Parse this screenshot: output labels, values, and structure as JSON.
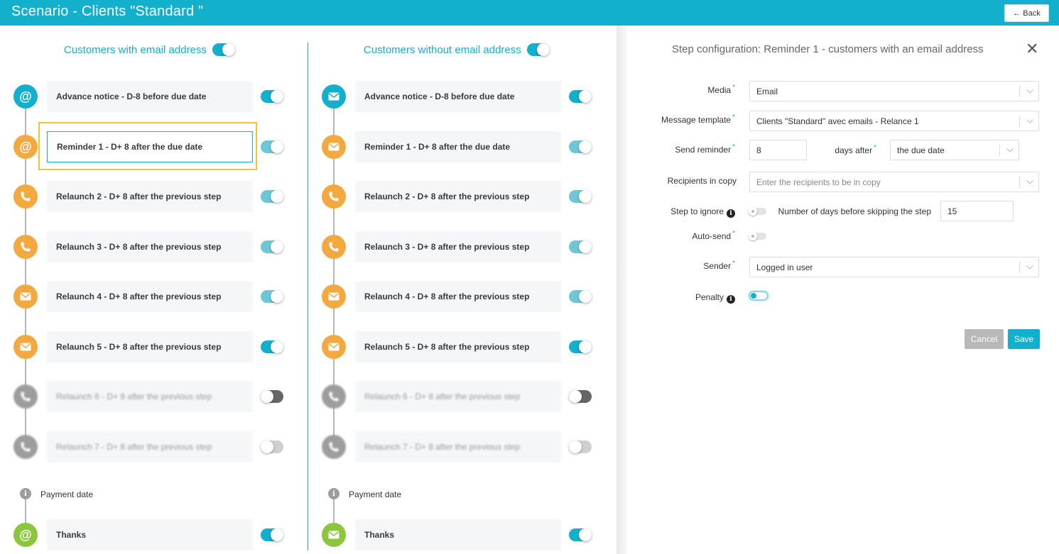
{
  "header": {
    "title": "Scenario - Clients \"Standard \"",
    "back_label": "← Back"
  },
  "columns": {
    "with_email": {
      "title": "Customers with email address",
      "toggle": "on"
    },
    "without_email": {
      "title": "Customers without email address",
      "toggle": "on"
    }
  },
  "steps_with_email": [
    {
      "label": "Advance notice - D-8 before due date",
      "icon": "at-icon",
      "color": "blue",
      "toggle": "on"
    },
    {
      "label": "Reminder 1 - D+ 8 after the due date",
      "icon": "at-icon",
      "color": "orange",
      "toggle": "on-light",
      "selected": true
    },
    {
      "label": "Relaunch 2 - D+ 8 after the previous step",
      "icon": "phone-icon",
      "color": "orange",
      "toggle": "on-light"
    },
    {
      "label": "Relaunch 3 - D+ 8 after the previous step",
      "icon": "phone-icon",
      "color": "orange",
      "toggle": "on-light"
    },
    {
      "label": "Relaunch 4 - D+ 8 after the previous step",
      "icon": "envelope-icon",
      "color": "orange",
      "toggle": "on-light"
    },
    {
      "label": "Relaunch 5 - D+ 8 after the previous step",
      "icon": "envelope-icon",
      "color": "orange",
      "toggle": "on"
    },
    {
      "label": "Relaunch 6 - D+ 8 after the previous step",
      "icon": "phone-icon",
      "color": "gray",
      "toggle": "off"
    },
    {
      "label": "Relaunch 7 - D+ 8 after the previous step",
      "icon": "phone-icon",
      "color": "gray",
      "toggle": "off-light"
    }
  ],
  "steps_without_email": [
    {
      "label": "Advance notice - D-8 before due date",
      "icon": "envelope-icon",
      "color": "blue",
      "toggle": "on"
    },
    {
      "label": "Reminder 1 - D+ 8 after the due date",
      "icon": "envelope-icon",
      "color": "orange",
      "toggle": "on-light"
    },
    {
      "label": "Relaunch 2 - D+ 8 after the previous step",
      "icon": "phone-icon",
      "color": "orange",
      "toggle": "on-light"
    },
    {
      "label": "Relaunch 3 - D+ 8 after the previous step",
      "icon": "phone-icon",
      "color": "orange",
      "toggle": "on-light"
    },
    {
      "label": "Relaunch 4 - D+ 8 after the previous step",
      "icon": "envelope-icon",
      "color": "orange",
      "toggle": "on-light"
    },
    {
      "label": "Relaunch 5 - D+ 8 after the previous step",
      "icon": "envelope-icon",
      "color": "orange",
      "toggle": "on"
    },
    {
      "label": "Relaunch 6 - D+ 8 after the previous step",
      "icon": "phone-icon",
      "color": "gray",
      "toggle": "off"
    },
    {
      "label": "Relaunch 7 - D+ 8 after the previous step",
      "icon": "phone-icon",
      "color": "gray",
      "toggle": "off-light"
    }
  ],
  "payment_date_label": "Payment date",
  "thanks": {
    "with_email": {
      "label": "Thanks",
      "icon": "at-icon",
      "color": "green",
      "toggle": "on"
    },
    "without_email": {
      "label": "Thanks",
      "icon": "envelope-icon",
      "color": "green",
      "toggle": "on"
    }
  },
  "config": {
    "title": "Step configuration: Reminder 1 - customers with an email address",
    "media": {
      "label": "Media",
      "value": "Email"
    },
    "template": {
      "label": "Message template",
      "value": "Clients \"Standard\" avec emails - Relance 1"
    },
    "send_reminder": {
      "label": "Send reminder",
      "value": "8",
      "days_after_label": "days after",
      "days_after_value": "the due date"
    },
    "recipients": {
      "label": "Recipients in copy",
      "placeholder": "Enter the recipients to be in copy"
    },
    "step_to_ignore": {
      "label": "Step to ignore",
      "days_label": "Number of days before skipping the step",
      "days_value": "15"
    },
    "auto_send": {
      "label": "Auto-send"
    },
    "sender": {
      "label": "Sender",
      "value": "Logged in user"
    },
    "penalty": {
      "label": "Penalty"
    },
    "cancel_label": "Cancel",
    "save_label": "Save"
  },
  "colors": {
    "accent": "#12b0cd",
    "orange": "#f3a940",
    "green": "#8cc63f",
    "gray": "#9d9d9d",
    "highlight": "#f4c430"
  }
}
